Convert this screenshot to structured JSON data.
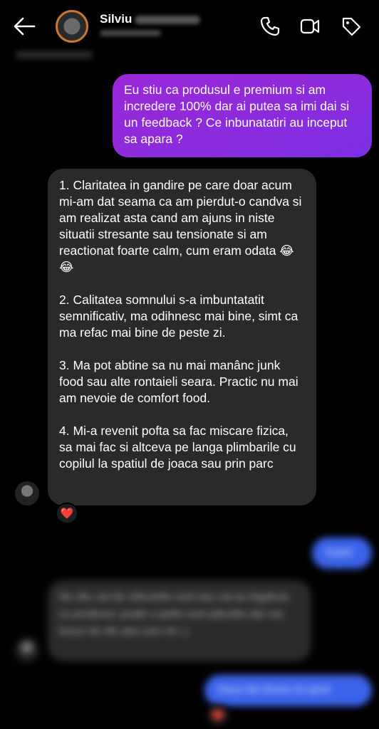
{
  "header": {
    "contact_name": "Silviu",
    "back_icon": "arrow-left-icon",
    "call_icon": "phone-icon",
    "video_icon": "video-camera-icon",
    "tag_icon": "tag-icon"
  },
  "messages": [
    {
      "id": "m1",
      "direction": "outgoing",
      "text": "Eu stiu ca produsul e premium si am incredere 100% dar ai putea sa imi dai si un feedback ? Ce inbunatatiri au inceput sa apara ?"
    },
    {
      "id": "m2",
      "direction": "incoming",
      "paragraphs": [
        "1. Claritatea in gandire pe care doar acum mi-am dat seama ca am pierdut-o candva si am realizat asta cand am ajuns in niste situatii stresante sau tensionate si am reactionat foarte calm, cum eram odata 😂😂",
        "2. Calitatea somnului s-a imbuntatatit semnificativ, ma odihnesc mai bine, simt ca ma refac mai bine de peste zi.",
        "3. Ma pot abtine sa nu mai manânc junk food sau alte rontaieli seara. Practic nu mai am nevoie de comfort food.",
        "4. Mi-a revenit pofta sa fac miscare fizica, sa mai fac si altceva pe langa plimbarile cu copilul la spatiul de joaca sau prin parc"
      ],
      "reaction": "❤️"
    },
    {
      "id": "m3",
      "direction": "outgoing",
      "text": "Super",
      "blurred": true
    },
    {
      "id": "m4",
      "direction": "incoming",
      "text": "Nu stiu cat de relevante sunt sau cat au legatura cu produsul, poate o parte sunt placebo dar ma bucur de ele asa cum vin :)",
      "blurred": true
    },
    {
      "id": "m5",
      "direction": "outgoing",
      "text": "Daca dai drumu la sport",
      "blurred": true,
      "reaction": "❤️"
    }
  ],
  "colors": {
    "outgoing_gradient_start": "#9a28d8",
    "outgoing_gradient_end": "#7b2fe4",
    "incoming_bg": "#2a2a2a",
    "blue_bubble": "#3c63ea",
    "background": "#000000"
  }
}
